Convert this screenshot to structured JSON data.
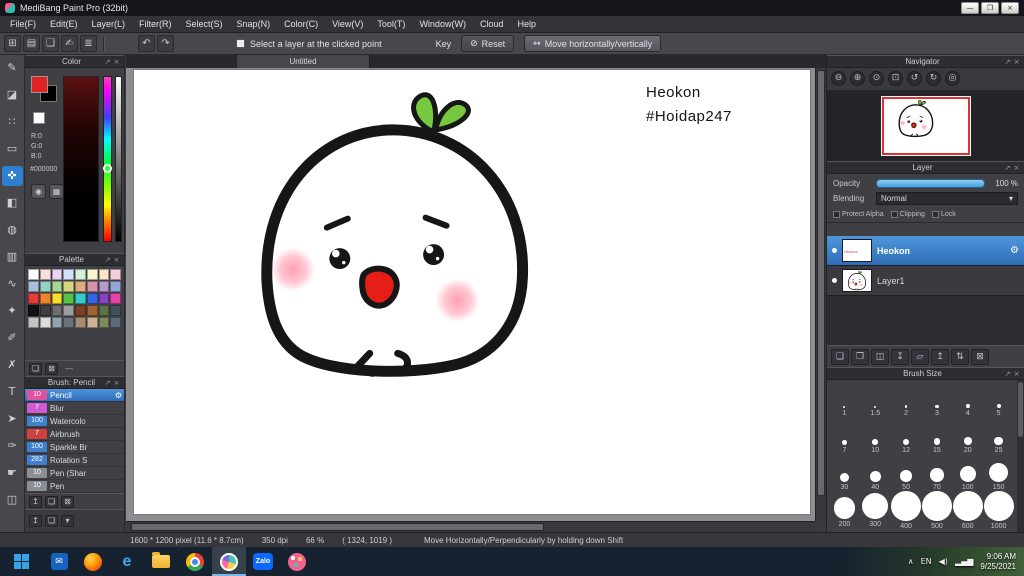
{
  "window": {
    "title": "MediBang Paint Pro (32bit)",
    "minimize": "—",
    "maximize": "❐",
    "close": "×"
  },
  "menu": {
    "items": [
      "File(F)",
      "Edit(E)",
      "Layer(L)",
      "Filter(R)",
      "Select(S)",
      "Snap(N)",
      "Color(C)",
      "View(V)",
      "Tool(T)",
      "Window(W)",
      "Cloud",
      "Help"
    ]
  },
  "toolbar": {
    "icons": [
      {
        "name": "transform-icon",
        "glyph": "⊞"
      },
      {
        "name": "canvas-icon",
        "glyph": "▤"
      },
      {
        "name": "comment-icon",
        "glyph": "❏"
      },
      {
        "name": "memo-icon",
        "glyph": "✍"
      },
      {
        "name": "list-icon",
        "glyph": "≣"
      }
    ],
    "undo_icon": "↶",
    "redo_icon": "↷",
    "select_layer_label": "Select a layer at the clicked point",
    "key_label": "Key",
    "reset_icon": "⊘",
    "reset_label": "Reset",
    "move_icon": "↔",
    "move_label": "Move horizontally/vertically"
  },
  "tools": [
    {
      "name": "brush-tool",
      "glyph": "✎"
    },
    {
      "name": "eraser-tool",
      "glyph": "◪"
    },
    {
      "name": "pixel-tool",
      "glyph": "∷"
    },
    {
      "name": "select-tool",
      "glyph": "▭"
    },
    {
      "name": "move-tool",
      "glyph": "✜",
      "selected": true
    },
    {
      "name": "fill-tool",
      "glyph": "◧"
    },
    {
      "name": "bucket-tool",
      "glyph": "◍"
    },
    {
      "name": "gradient-tool",
      "glyph": "▥"
    },
    {
      "name": "lasso-tool",
      "glyph": "∿"
    },
    {
      "name": "magic-wand-tool",
      "glyph": "✦"
    },
    {
      "name": "select-pen-tool",
      "glyph": "✐"
    },
    {
      "name": "select-eraser-tool",
      "glyph": "✗"
    },
    {
      "name": "text-tool",
      "glyph": "T"
    },
    {
      "name": "operation-tool",
      "glyph": "➤"
    },
    {
      "name": "eyedropper-tool",
      "glyph": "✑"
    },
    {
      "name": "hand-tool",
      "glyph": "☛"
    },
    {
      "name": "divide-tool",
      "glyph": "◫"
    }
  ],
  "color_panel": {
    "title": "Color",
    "r": "R:0",
    "g": "G:0",
    "b": "B:0",
    "hex": "#000000",
    "fg_color": "#e02222",
    "bg_color": "#000000",
    "picker_icon": "◉",
    "grid_icon": "▦"
  },
  "palette_panel": {
    "title": "Palette",
    "colors": [
      [
        "#ffffff",
        "#fbdede",
        "#ecd4f4",
        "#d7def8",
        "#d3f0db",
        "#f8f6cf",
        "#fbe6c9",
        "#f3cfdb"
      ],
      [
        "#a8bedc",
        "#93d2c5",
        "#a9d793",
        "#d6d680",
        "#dcab81",
        "#d294a6",
        "#b69ace",
        "#93a7d2"
      ],
      [
        "#e43b3b",
        "#f08228",
        "#f5df33",
        "#54c244",
        "#35cbcb",
        "#3565e2",
        "#8343c4",
        "#e243a4"
      ],
      [
        "#111111",
        "#3f3f3f",
        "#6f6f6f",
        "#9f9f9f",
        "#7f4021",
        "#a06233",
        "#5f7047",
        "#40515f"
      ],
      [
        "#c4c4c4",
        "#dcdcdc",
        "#93a3ab",
        "#6a727a",
        "#aa8a72",
        "#cab292",
        "#7a8a5a",
        "#5a6a7a"
      ]
    ],
    "footer_icons": [
      {
        "name": "add-color-button",
        "glyph": "❏"
      },
      {
        "name": "delete-color-button",
        "glyph": "⊠"
      }
    ],
    "separator_label": "---"
  },
  "brush_panel": {
    "title": "Brush: Pencil",
    "brushes": [
      {
        "size": "10",
        "name": "Pencil",
        "badge": "#e0519e",
        "selected": true
      },
      {
        "size": "7",
        "name": "Blur",
        "badge": "#cf5ad6"
      },
      {
        "size": "100",
        "name": "Watercolo",
        "badge": "#3f7fd0"
      },
      {
        "size": "7",
        "name": "Airbrush",
        "badge": "#d04040"
      },
      {
        "size": "100",
        "name": "Sparkle Br",
        "badge": "#3f7fd0"
      },
      {
        "size": "282",
        "name": "Rotation S",
        "badge": "#3f7fd0"
      },
      {
        "size": "10",
        "name": "Pen (Shar",
        "badge": "#8a8f96"
      },
      {
        "size": "10",
        "name": "Pen",
        "badge": "#8a8f96"
      }
    ],
    "footer_icons": [
      {
        "name": "brush-up-button",
        "glyph": "↥"
      },
      {
        "name": "add-brush-button",
        "glyph": "❏"
      },
      {
        "name": "delete-brush-button",
        "glyph": "⊠"
      }
    ]
  },
  "dock": {
    "icons": [
      {
        "name": "dock-up-button",
        "glyph": "↥"
      },
      {
        "name": "dock-panels-button",
        "glyph": "❏"
      },
      {
        "name": "dock-down-button",
        "glyph": "▾"
      }
    ]
  },
  "canvas": {
    "tab_title": "Untitled",
    "annotation_line1": "Heokon",
    "annotation_line2": "#Hoidap247"
  },
  "navigator": {
    "title": "Navigator",
    "buttons": [
      {
        "name": "zoom-out-button",
        "glyph": "⊖"
      },
      {
        "name": "zoom-in-button",
        "glyph": "⊕"
      },
      {
        "name": "zoom-reset-button",
        "glyph": "⊙"
      },
      {
        "name": "fit-window-button",
        "glyph": "⊡"
      },
      {
        "name": "rotate-left-button",
        "glyph": "↺"
      },
      {
        "name": "rotate-right-button",
        "glyph": "↻"
      },
      {
        "name": "reset-rotation-button",
        "glyph": "◎"
      }
    ]
  },
  "layer_panel": {
    "title": "Layer",
    "opacity_label": "Opacity",
    "opacity_value": "100 %",
    "blending_label": "Blending",
    "blending_value": "Normal",
    "dropdown_arrow": "▾",
    "protect_alpha_label": "Protect Alpha",
    "clipping_label": "Clipping",
    "lock_label": "Lock",
    "layers": [
      {
        "name": "Heokon",
        "selected": true
      },
      {
        "name": "Layer1"
      }
    ],
    "buttons": [
      {
        "name": "add-layer-button",
        "glyph": "❏"
      },
      {
        "name": "duplicate-layer-button",
        "glyph": "❐"
      },
      {
        "name": "merge-layer-button",
        "glyph": "◫"
      },
      {
        "name": "transfer-layer-button",
        "glyph": "↧"
      },
      {
        "name": "add-folder-button",
        "glyph": "▱"
      },
      {
        "name": "raise-layer-button",
        "glyph": "↥"
      },
      {
        "name": "reorder-layer-button",
        "glyph": "⇅"
      },
      {
        "name": "delete-layer-button",
        "glyph": "⊠"
      }
    ]
  },
  "brush_size_panel": {
    "title": "Brush Size",
    "sizes": [
      [
        "1",
        "1.5",
        "2",
        "3",
        "4",
        "5"
      ],
      [
        "7",
        "10",
        "12",
        "15",
        "20",
        "25"
      ],
      [
        "30",
        "40",
        "50",
        "70",
        "100",
        "150"
      ],
      [
        "200",
        "300",
        "400",
        "500",
        "600",
        "1000"
      ]
    ]
  },
  "status_bar": {
    "doc_info": "1600 * 1200 pixel   (11.6 * 8.7cm)",
    "dpi": "350 dpi",
    "zoom": "66 %",
    "coords": "( 1324, 1019 )",
    "hint": "Move Horizontally/Perpendicularly by holding down Shift"
  },
  "taskbar": {
    "mail_icon": "✉",
    "edge_label": "e",
    "zalo_label": "Zalo",
    "tray_collapse_icon": "∧",
    "tray_lang": "EN",
    "tray_volume_icon": "◀)",
    "tray_network_icon": "▂▄▆",
    "time": "9:06 AM",
    "date": "9/25/2021"
  },
  "icons": {
    "gear": "⚙",
    "popout": "↗",
    "close": "×",
    "eye": "●"
  }
}
